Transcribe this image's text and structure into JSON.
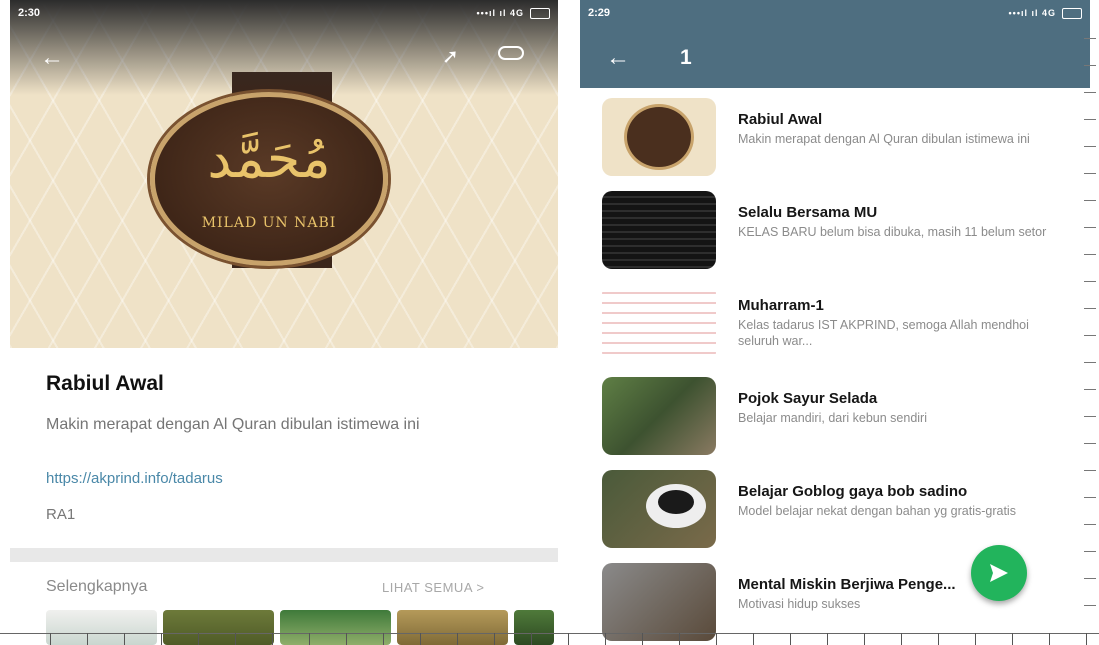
{
  "left": {
    "status": {
      "time": "2:30",
      "signal": "•••ıl ıl 4G"
    },
    "hero": {
      "script": "مُحَمَّد",
      "caption": "MILAD UN NABI"
    },
    "group": {
      "title": "Rabiul Awal",
      "description": "Makin merapat dengan Al Quran dibulan istimewa ini",
      "url": "https://akprind.info/tadarus",
      "code": "RA1"
    },
    "more": {
      "label": "Selengkapnya",
      "link": "LIHAT SEMUA >"
    }
  },
  "right": {
    "status": {
      "time": "2:29",
      "signal": "•••ıl ıl 4G"
    },
    "appbar": {
      "title": "1"
    },
    "chats": [
      {
        "title": "Rabiul Awal",
        "subtitle": "Makin merapat dengan Al Quran dibulan istimewa ini"
      },
      {
        "title": "Selalu Bersama MU",
        "subtitle": "KELAS BARU belum bisa dibuka, masih 11 belum setor"
      },
      {
        "title": "Muharram-1",
        "subtitle": "Kelas tadarus IST AKPRIND, semoga Allah mendhoi seluruh war..."
      },
      {
        "title": "Pojok Sayur Selada",
        "subtitle": "Belajar mandiri, dari kebun sendiri"
      },
      {
        "title": "Belajar Goblog gaya bob sadino",
        "subtitle": "Model belajar nekat dengan bahan yg gratis-gratis"
      },
      {
        "title": "Mental Miskin Berjiwa Penge...",
        "subtitle": "Motivasi hidup sukses"
      }
    ]
  },
  "icons": {
    "back": "arrow-left-icon",
    "share": "share-icon",
    "link": "link-icon",
    "send": "send-icon"
  },
  "colors": {
    "appbar": "#4e6e80",
    "fab": "#22b45c",
    "link": "#4a88a8"
  }
}
